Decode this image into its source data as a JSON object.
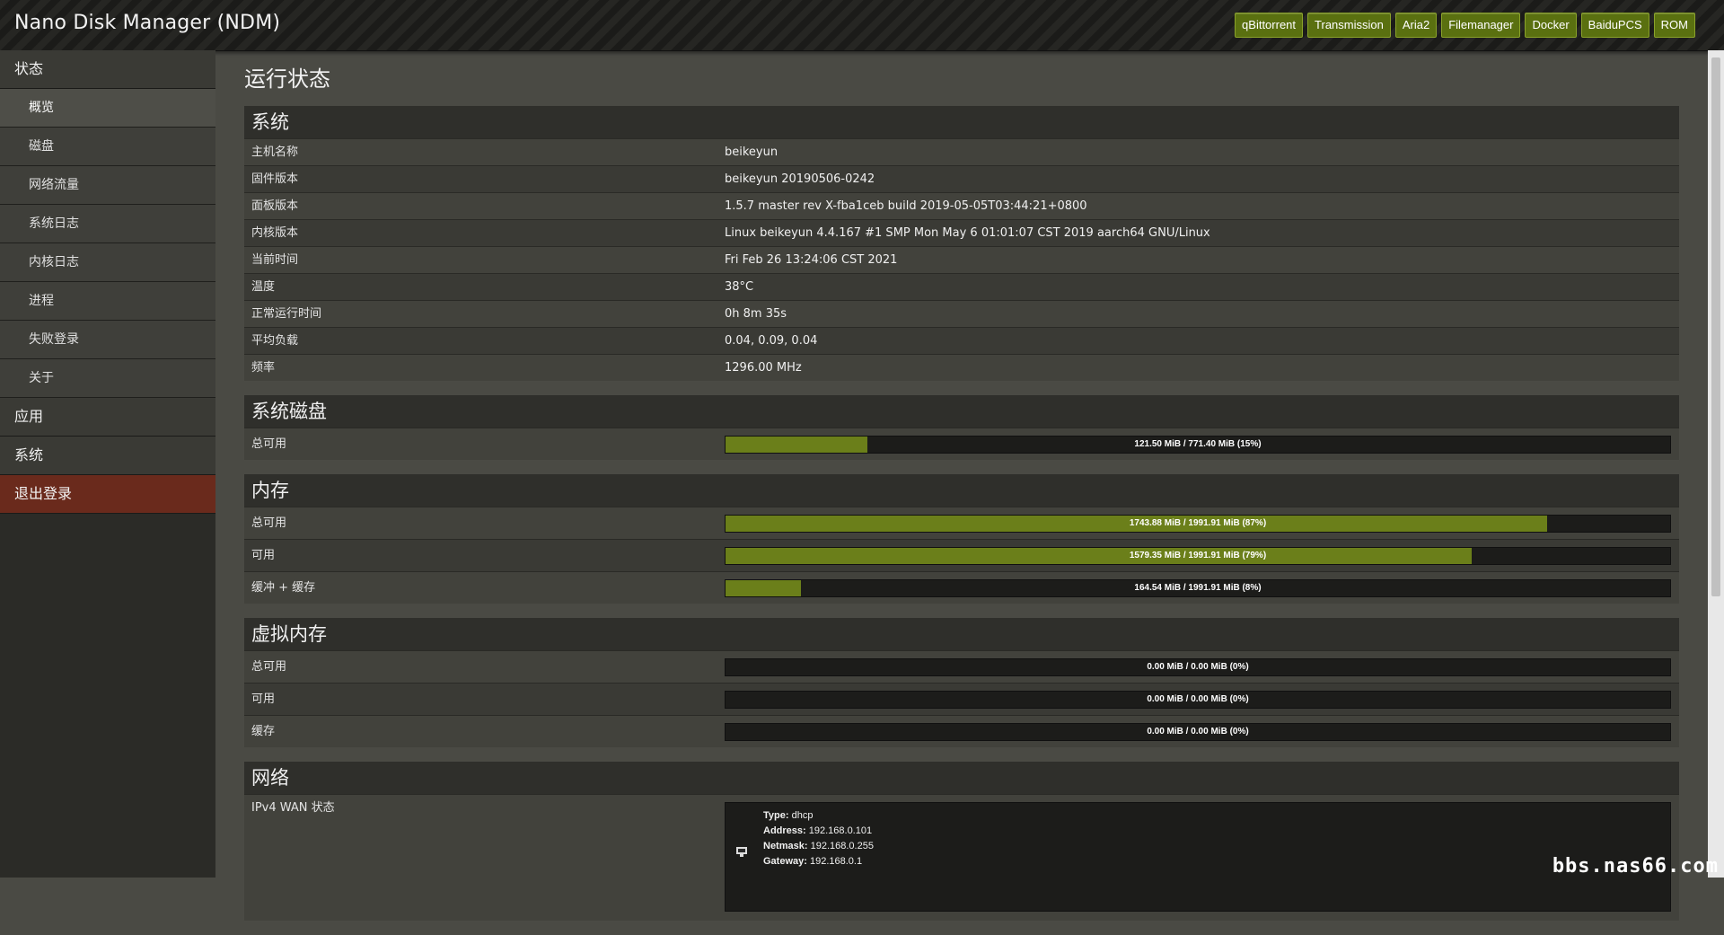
{
  "header": {
    "title": "Nano Disk Manager (NDM)",
    "links": [
      "qBittorrent",
      "Transmission",
      "Aria2",
      "Filemanager",
      "Docker",
      "BaiduPCS",
      "ROM"
    ]
  },
  "sidebar": {
    "status": "状态",
    "sub": [
      "概览",
      "磁盘",
      "网络流量",
      "系统日志",
      "内核日志",
      "进程",
      "失败登录",
      "关于"
    ],
    "apps": "应用",
    "system": "系统",
    "logout": "退出登录"
  },
  "main": {
    "title": "运行状态",
    "system": {
      "title": "系统",
      "rows": [
        {
          "k": "主机名称",
          "v": "beikeyun"
        },
        {
          "k": "固件版本",
          "v": "beikeyun 20190506-0242"
        },
        {
          "k": "面板版本",
          "v": "1.5.7 master rev X-fba1ceb build 2019-05-05T03:44:21+0800"
        },
        {
          "k": "内核版本",
          "v": "Linux beikeyun 4.4.167 #1 SMP Mon May 6 01:01:07 CST 2019 aarch64 GNU/Linux"
        },
        {
          "k": "当前时间",
          "v": "Fri Feb 26 13:24:06 CST 2021"
        },
        {
          "k": "温度",
          "v": "38°C"
        },
        {
          "k": "正常运行时间",
          "v": "0h 8m 35s"
        },
        {
          "k": "平均负载",
          "v": "0.04, 0.09, 0.04"
        },
        {
          "k": "频率",
          "v": "1296.00 MHz"
        }
      ]
    },
    "disk": {
      "title": "系统磁盘",
      "rows": [
        {
          "k": "总可用",
          "label": "121.50 MiB / 771.40 MiB (15%)",
          "percent": 15
        }
      ]
    },
    "memory": {
      "title": "内存",
      "rows": [
        {
          "k": "总可用",
          "label": "1743.88 MiB / 1991.91 MiB (87%)",
          "percent": 87
        },
        {
          "k": "可用",
          "label": "1579.35 MiB / 1991.91 MiB (79%)",
          "percent": 79
        },
        {
          "k": "缓冲 + 缓存",
          "label": "164.54 MiB / 1991.91 MiB (8%)",
          "percent": 8
        }
      ]
    },
    "swap": {
      "title": "虚拟内存",
      "rows": [
        {
          "k": "总可用",
          "label": "0.00 MiB / 0.00 MiB (0%)",
          "percent": 0
        },
        {
          "k": "可用",
          "label": "0.00 MiB / 0.00 MiB (0%)",
          "percent": 0
        },
        {
          "k": "缓存",
          "label": "0.00 MiB / 0.00 MiB (0%)",
          "percent": 0
        }
      ]
    },
    "network": {
      "title": "网络",
      "wan_label": "IPv4 WAN 状态",
      "type_k": "Type:",
      "type_v": "dhcp",
      "address_k": "Address:",
      "address_v": "192.168.0.101",
      "netmask_k": "Netmask:",
      "netmask_v": "192.168.0.255",
      "gateway_k": "Gateway:",
      "gateway_v": "192.168.0.1"
    }
  },
  "watermark": "bbs.nas66.com"
}
